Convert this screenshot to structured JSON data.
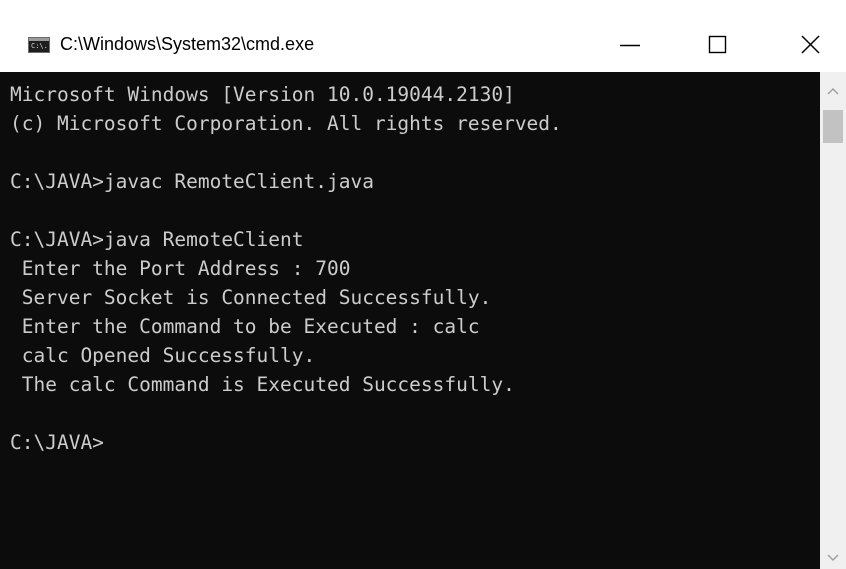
{
  "window": {
    "title": "C:\\Windows\\System32\\cmd.exe",
    "icon_label": "C:\\.",
    "icon": "cmd-icon",
    "controls": {
      "minimize_icon": "minimize-icon",
      "maximize_icon": "maximize-icon",
      "close_icon": "close-icon"
    }
  },
  "console": {
    "lines": [
      "Microsoft Windows [Version 10.0.19044.2130]",
      "(c) Microsoft Corporation. All rights reserved.",
      "",
      "C:\\JAVA>javac RemoteClient.java",
      "",
      "C:\\JAVA>java RemoteClient",
      " Enter the Port Address : 700",
      " Server Socket is Connected Successfully.",
      " Enter the Command to be Executed : calc",
      " calc Opened Successfully.",
      " The calc Command is Executed Successfully.",
      "",
      "C:\\JAVA>"
    ]
  },
  "scrollbar": {
    "up_icon": "chevron-up-icon",
    "down_icon": "chevron-down-icon"
  },
  "colors": {
    "console_background": "#0c0c0c",
    "console_text": "#cccccc",
    "titlebar_background": "#ffffff"
  }
}
